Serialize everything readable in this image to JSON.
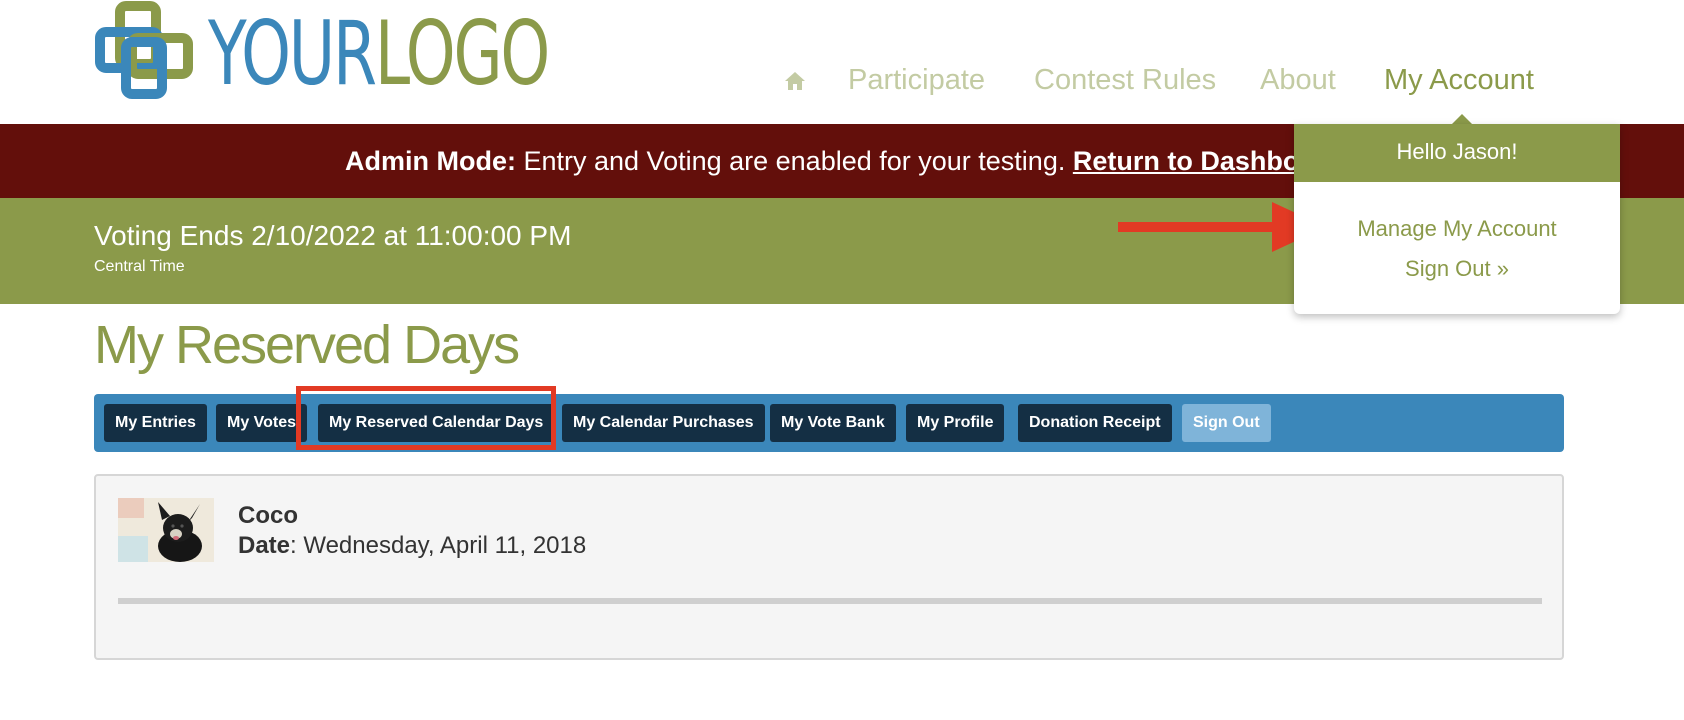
{
  "logo": {
    "text_part1": "YOUR",
    "text_part2": "LOGO"
  },
  "nav": {
    "home_icon": "home-icon",
    "items": [
      "Participate",
      "Contest Rules",
      "About",
      "My Account"
    ]
  },
  "admin_bar": {
    "label": "Admin Mode:",
    "message": " Entry and Voting are enabled for your testing. ",
    "link": "Return to Dashboard"
  },
  "voting": {
    "title": "Voting Ends 2/10/2022 at 11:00:00 PM",
    "subtitle": "Central Time"
  },
  "account_dropdown": {
    "greeting": "Hello Jason!",
    "manage": "Manage My Account",
    "sign_out": "Sign Out »"
  },
  "page": {
    "title": "My Reserved Days"
  },
  "tabs": [
    "My Entries",
    "My Votes",
    "My Reserved Calendar Days",
    "My Calendar Purchases",
    "My Vote Bank",
    "My Profile",
    "Donation Receipt",
    "Sign Out"
  ],
  "entry": {
    "name": "Coco",
    "date_label": "Date",
    "date_value": ": Wednesday, April 11, 2018"
  },
  "colors": {
    "olive": "#8b9a4a",
    "maroon": "#630f0b",
    "blue": "#3b87ba",
    "navy": "#142f44",
    "red_annotation": "#e23a24"
  }
}
